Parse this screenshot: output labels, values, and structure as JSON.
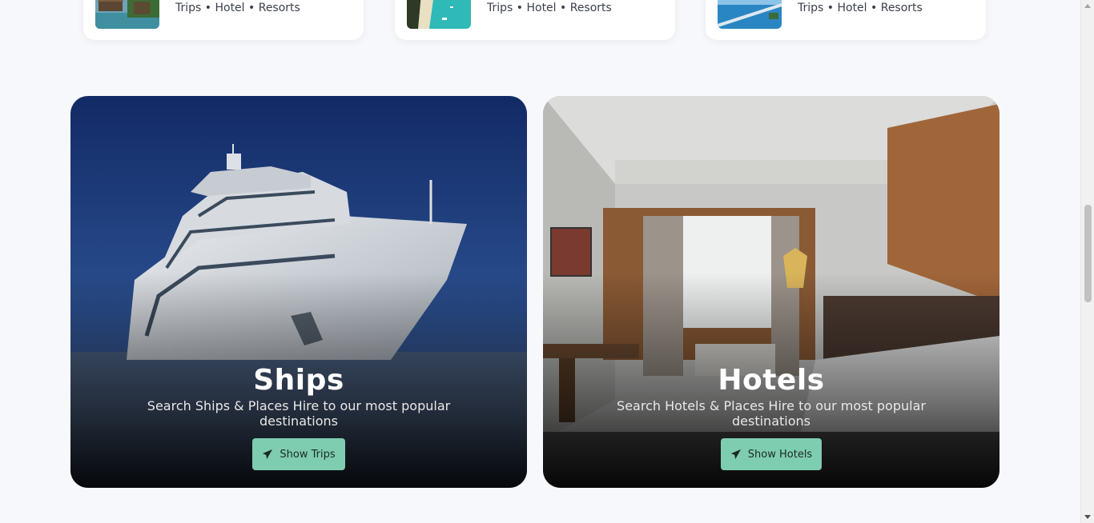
{
  "destination_cards": [
    {
      "tags": "Trips • Hotel • Resorts",
      "thumb_icon": "overwater-bungalow-photo"
    },
    {
      "tags": "Trips • Hotel • Resorts",
      "thumb_icon": "tropical-beach-photo"
    },
    {
      "tags": "Trips • Hotel • Resorts",
      "thumb_icon": "coastal-bridge-photo"
    }
  ],
  "promos": {
    "ships": {
      "title": "Ships",
      "description": "Search Ships & Places Hire to our most popular destinations",
      "button_label": "Show Trips",
      "button_icon": "paper-plane-icon"
    },
    "hotels": {
      "title": "Hotels",
      "description": "Search Hotels & Places Hire to our most popular destinations",
      "button_label": "Show Hotels",
      "button_icon": "paper-plane-icon"
    }
  },
  "colors": {
    "page_background": "#f7f8fb",
    "button_accent": "#7fcdb0",
    "card_text": "#3a3f4a"
  }
}
